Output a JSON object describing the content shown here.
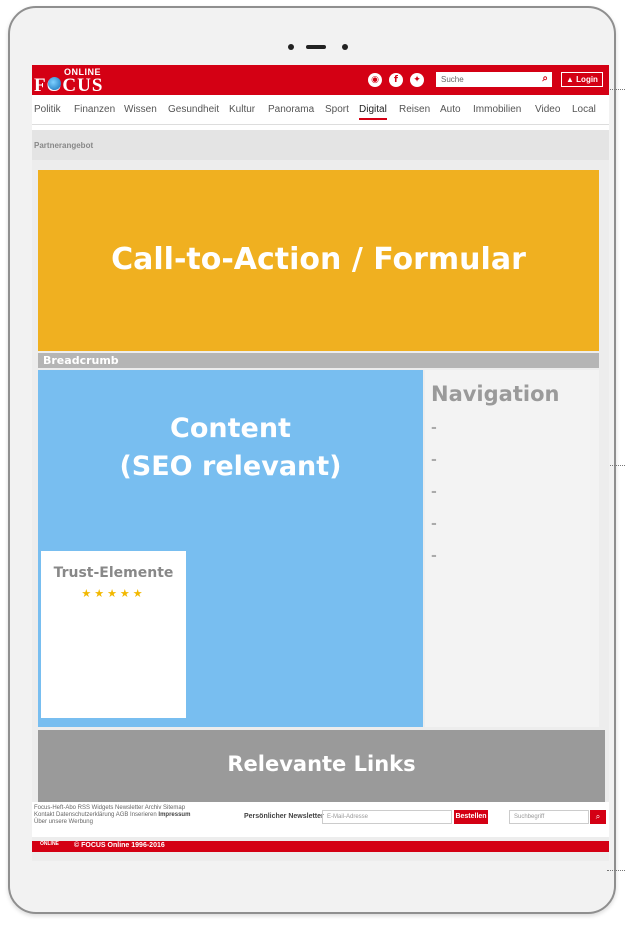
{
  "header": {
    "logo_online": "ONLINE",
    "logo_brand": "FOCUS",
    "search_placeholder": "Suche",
    "login_label": "Login"
  },
  "social_icons": [
    "podcast-icon",
    "facebook-icon",
    "twitter-icon"
  ],
  "nav": {
    "items": [
      "Politik",
      "Finanzen",
      "Wissen",
      "Gesundheit",
      "Kultur",
      "Panorama",
      "Sport",
      "Digital",
      "Reisen",
      "Auto",
      "Immobilien",
      "Video",
      "Local"
    ],
    "active": "Digital"
  },
  "partner_label": "Partnerangebot",
  "cta": {
    "title": "Call-to-Action / Formular"
  },
  "breadcrumb": "Breadcrumb",
  "content": {
    "line1": "Content",
    "line2": "(SEO relevant)"
  },
  "trust": {
    "title": "Trust-Elemente",
    "stars": "★★★★★"
  },
  "sidebar": {
    "title": "Navigation",
    "dashes": [
      "-",
      "-",
      "-",
      "-",
      "-"
    ]
  },
  "links": {
    "title": "Relevante Links"
  },
  "footer": {
    "links_row1": "Focus-Heft-Abo   RSS   Widgets   Newsletter   Archiv   Sitemap",
    "links_row2a": "Kontakt   Datenschutzerklärung   AGB   Inserieren   ",
    "links_row2b": "Impressum",
    "links_row3": "Über unsere Werbung",
    "newsletter_label": "Persönlicher Newsletter",
    "email_placeholder": "E-Mail-Adresse",
    "subscribe_button": "Bestellen",
    "search_placeholder": "Suchbegriff"
  },
  "bottom": {
    "mini_logo": "ONLINE",
    "copyright": "© FOCUS Online 1996-2016"
  },
  "colors": {
    "brand_red": "#d40014",
    "cta_orange": "#f0b020",
    "content_blue": "#78bef0",
    "links_gray": "#9a9a9a"
  }
}
